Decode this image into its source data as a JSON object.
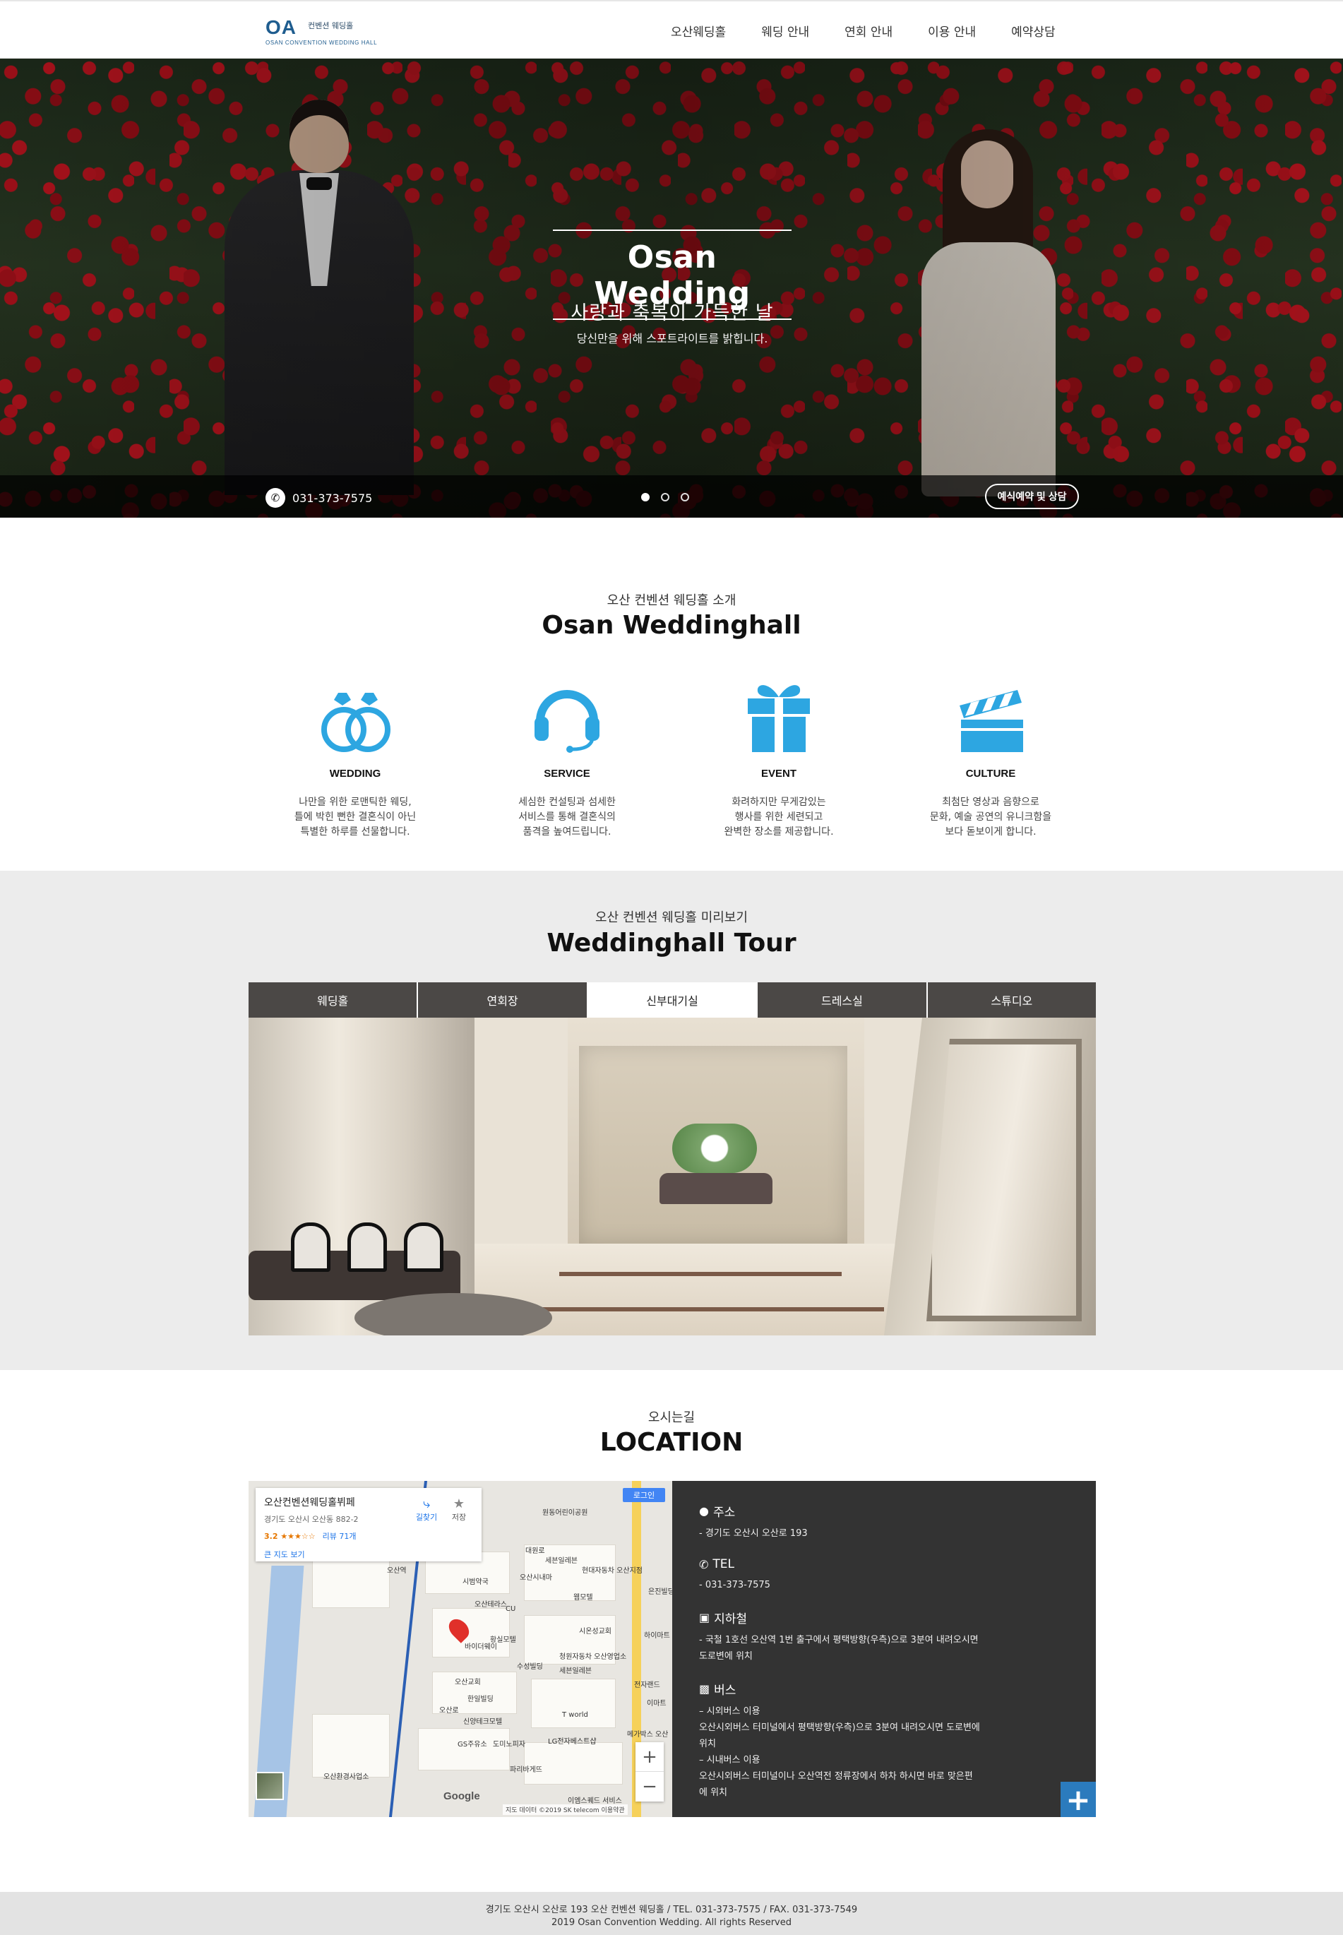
{
  "header": {
    "logo_mark": "OA",
    "logo_ko": "컨벤션 웨딩홀",
    "logo_en": "OSAN CONVENTION WEDDING HALL",
    "nav": [
      "오산웨딩홀",
      "웨딩 안내",
      "연회 안내",
      "이용 안내",
      "예약상담"
    ]
  },
  "hero": {
    "title": "Osan Wedding",
    "subtitle": "사랑과 축복이 가득한 날",
    "tagline": "당신만을 위해 스포트라이트를 밝힙니다.",
    "phone": "031-373-7575",
    "reserve_label": "예식예약 및 상담",
    "slides": 3,
    "active_slide": 1
  },
  "intro": {
    "sub": "오산 컨벤션 웨딩홀 소개",
    "title": "Osan Weddinghall",
    "features": [
      {
        "icon": "rings-icon",
        "title": "WEDDING",
        "lines": [
          "나만을 위한 로맨틱한 웨딩,",
          "틀에 박힌 뻔한 결혼식이 아닌",
          "특별한 하루를 선물합니다."
        ]
      },
      {
        "icon": "headset-icon",
        "title": "SERVICE",
        "lines": [
          "세심한 컨설팅과 섬세한",
          "서비스를 통해 결혼식의",
          "품격을 높여드립니다."
        ]
      },
      {
        "icon": "gift-icon",
        "title": "EVENT",
        "lines": [
          "화려하지만 무게감있는",
          "행사를 위한 세련되고",
          "완벽한 장소를 제공합니다."
        ]
      },
      {
        "icon": "clapperboard-icon",
        "title": "CULTURE",
        "lines": [
          "최첨단 영상과 음향으로",
          "문화, 예술 공연의 유니크함을",
          "보다 돋보이게 합니다."
        ]
      }
    ]
  },
  "tour": {
    "sub": "오산 컨벤션 웨딩홀 미리보기",
    "title": "Weddinghall Tour",
    "tabs": [
      "웨딩홀",
      "연회장",
      "신부대기실",
      "드레스실",
      "스튜디오"
    ],
    "active_tab": 2
  },
  "location": {
    "sub": "오시는길",
    "title": "LOCATION",
    "map": {
      "place_name": "오산컨벤션웨딩홀뷔페",
      "address": "경기도 오산시 오산동 882-2",
      "rating": "3.2 ★★★☆☆",
      "reviews": "리뷰 71개",
      "large_map": "큰 지도 보기",
      "directions": "길찾기",
      "save": "저장",
      "login": "로그인",
      "google": "Google",
      "footer": "지도 데이터 ©2019 SK telecom   이용약관",
      "labels": [
        "원동어린이공원",
        "대원로",
        "세븐일레븐",
        "현대자동차 오산지점",
        "시범약국",
        "오산시내마",
        "웹모텔",
        "오산테라스",
        "은진빌딩",
        "시온성교회",
        "하이마트",
        "황실모텔",
        "바이더웨이",
        "청원자동차 오산영업소",
        "수성빌딩",
        "세븐일레븐",
        "오산교회",
        "전자랜드",
        "한일빌딩",
        "오산로",
        "이마트",
        "신양테크모텔",
        "T world",
        "GS주유소",
        "도미노피자",
        "LG전자베스트샵",
        "메가박스 오산",
        "파리바게뜨",
        "오산환경사업소",
        "이엠스퀘드 서비스",
        "CU",
        "오산역"
      ]
    },
    "info": [
      {
        "icon": "pin-icon",
        "title": "주소",
        "lines": [
          "- 경기도 오산시 오산로 193"
        ]
      },
      {
        "icon": "phone-icon",
        "title": "TEL",
        "lines": [
          "- 031-373-7575"
        ]
      },
      {
        "icon": "subway-icon",
        "title": "지하철",
        "lines": [
          "- 국철 1호선 오산역 1번 출구에서 평택방향(우측)으로 3분여 내려오시면",
          "도로변에 위치"
        ]
      },
      {
        "icon": "bus-icon",
        "title": "버스",
        "lines": [
          "– 시외버스 이용",
          "오산시외버스 터미널에서 평택방향(우측)으로 3분여 내려오시면 도로변에",
          "위치",
          "– 시내버스 이용",
          "오산시외버스 터미널이나 오산역전 정류장에서 하차 하시면 바로 맞은편",
          "에 위치"
        ]
      }
    ],
    "more": "+"
  },
  "footer": {
    "line1": "경기도 오산시 오산로 193 오산 컨벤션 웨딩홀 / TEL. 031-373-7575 / FAX. 031-373-7549",
    "line2": "2019 Osan Convention Wedding. All rights Reserved"
  }
}
